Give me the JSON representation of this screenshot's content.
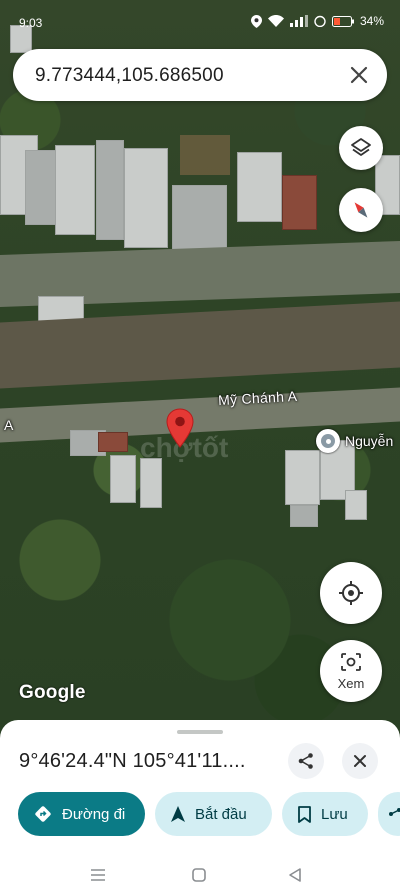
{
  "status_bar": {
    "time": "9:03",
    "battery": "34%"
  },
  "search": {
    "query": "9.773444,105.686500"
  },
  "map": {
    "street_label": "Mỹ Chánh A",
    "street_label_left": "A",
    "place_label": "Nguyễn",
    "watermark": "chợtốt",
    "google_logo": "Google",
    "lens_label": "Xem"
  },
  "sheet": {
    "coordinates": "9°46'24.4\"N 105°41'11....",
    "actions": {
      "directions": "Đường đi",
      "start": "Bắt đầu",
      "save": "Lưu"
    }
  },
  "colors": {
    "accent": "#0b7b86",
    "chip_bg": "#d3eef3",
    "pin": "#e53935"
  }
}
